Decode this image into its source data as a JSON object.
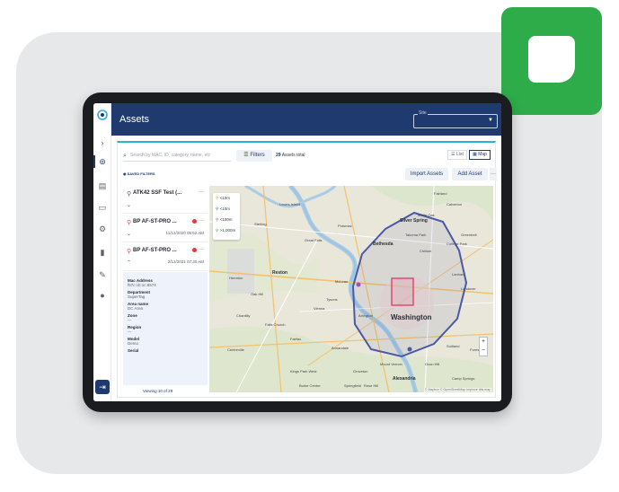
{
  "colors": {
    "nav": "#1e3a6e",
    "accent": "#2ab0d8",
    "brand_green": "#2eac4a",
    "geofence": "#4a58a8",
    "highlight": "#e0436b"
  },
  "app": {
    "title": "Assets",
    "site_label": "Site"
  },
  "toolbar": {
    "search_placeholder": "Search by MAC, ID, category, name, etc",
    "filters_label": "Filters",
    "assets_count": "29",
    "assets_suffix": "Assets total",
    "view_list": "List",
    "view_map": "Map",
    "saved_filters": "SAVED FILTERS",
    "import_label": "Import Assets",
    "add_label": "Add Asset",
    "more_label": "···"
  },
  "assets": [
    {
      "name": "ATK42 SSF Test (...",
      "date": "",
      "pin_color": "#5a6170"
    },
    {
      "name": "BP AF-ST-PRO ...",
      "date": "11/12/2020 05:52 AM",
      "pin_color": "#e0436b"
    },
    {
      "name": "BP AF-ST-PRO ...",
      "date": "2/12/2021 07:30 AM",
      "pin_color": "#e0436b"
    }
  ],
  "details": [
    {
      "key": "Mac Address",
      "value": "f57c:cb:1c:8574"
    },
    {
      "key": "Department",
      "value": "SuperTag"
    },
    {
      "key": "Area name",
      "value": "DC Area"
    },
    {
      "key": "Zone",
      "value": "---"
    },
    {
      "key": "Region",
      "value": "---"
    },
    {
      "key": "Model",
      "value": "Demo"
    },
    {
      "key": "Serial",
      "value": ""
    }
  ],
  "pager": {
    "text": "Viewing 10 of 29"
  },
  "map": {
    "legend": [
      {
        "label": "<10m",
        "color": "#f08a24"
      },
      {
        "label": "<10m",
        "color": "#4a58a8"
      },
      {
        "label": "<100m",
        "color": "#9b4fc2"
      },
      {
        "label": ">1,000m",
        "color": "#3aa83a"
      }
    ],
    "labels": {
      "washington": "Washington",
      "bethesda": "Bethesda",
      "silver_spring": "Silver Spring",
      "reston": "Reston",
      "mclean": "McLean",
      "fairfax": "Fairfax",
      "alexandria": "Alexandria",
      "arlington": "Arlington",
      "chantilly": "Chantilly",
      "potomac": "Potomac",
      "fairland": "Fairland",
      "greenbelt": "Greenbelt",
      "landover": "Landover",
      "suitland": "Suitland",
      "oxon_hill": "Oxon Hill",
      "great_falls": "Great Falls",
      "tysons": "Tysons",
      "college_park": "College Park",
      "annandale": "Annandale",
      "springfield": "Springfield",
      "lowes_island": "Lowes Island",
      "sterling": "Sterling",
      "herndon": "Herndon",
      "vienna": "Vienna",
      "falls_church": "Falls Church",
      "oak_hill": "Oak Hill",
      "centreville": "Centreville",
      "burke": "Burke Centre",
      "kings_park": "Kings Park West",
      "white_oak": "White Oak",
      "calverton": "Calverton",
      "takoma": "Takoma Park",
      "chillum": "Chillum",
      "lanham": "Lanham",
      "camp_springs": "Camp Springs",
      "forest": "Forest",
      "mount_vernon": "Mount Vernon",
      "rosa_hill": "Rose Hill",
      "groveton": "Groveton",
      "attribution": "© Mapbox © OpenStreetMap Improve this map"
    }
  }
}
